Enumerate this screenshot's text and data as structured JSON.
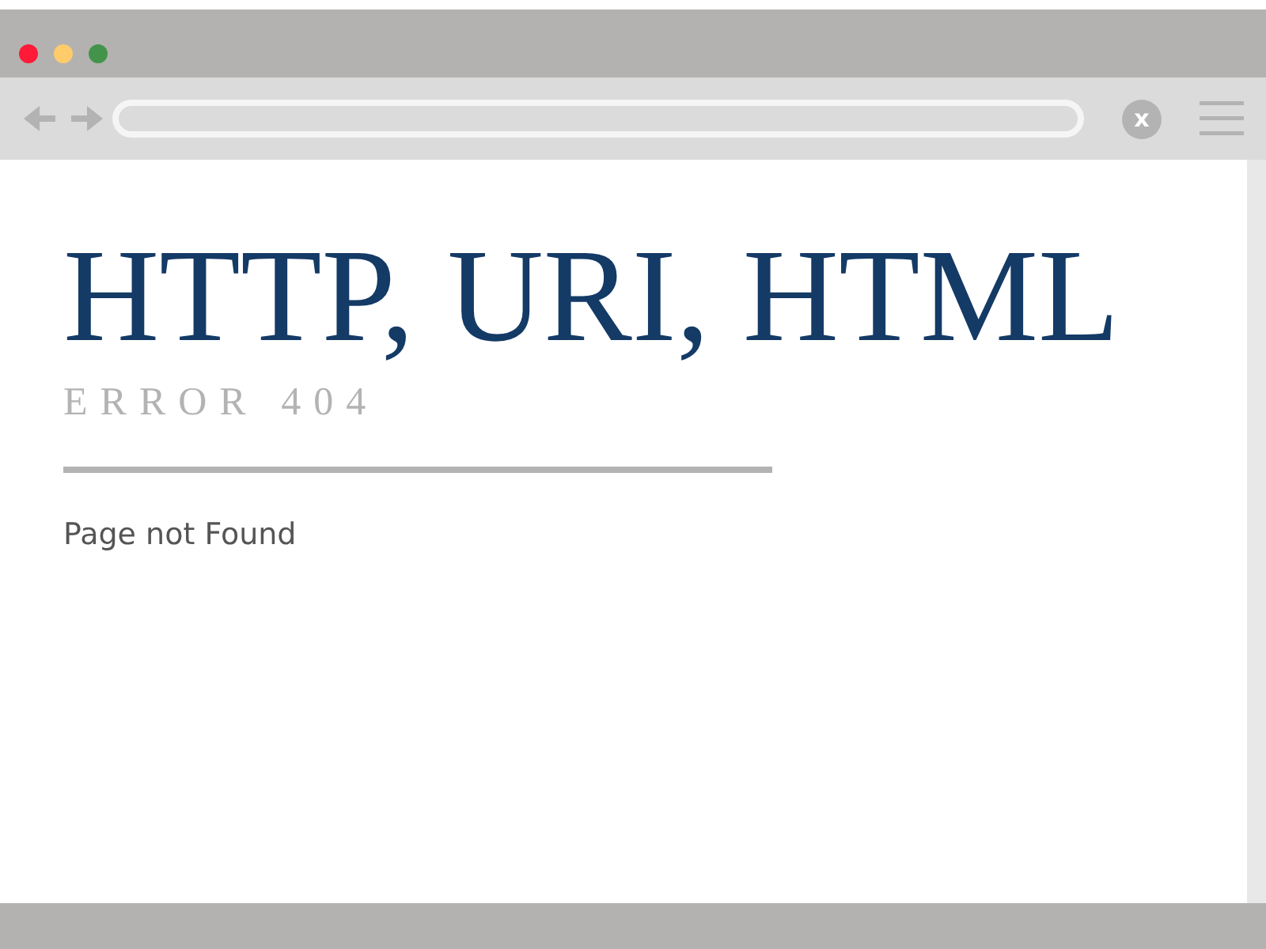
{
  "window": {
    "controls": [
      {
        "color": "#ff1a38"
      },
      {
        "color": "#ffcb6b"
      },
      {
        "color": "#43944a"
      }
    ]
  },
  "toolbar": {
    "close_button": "x"
  },
  "page": {
    "title": "HTTP, URI, HTML",
    "subtitle": "ERROR 404",
    "message": "Page not Found"
  }
}
